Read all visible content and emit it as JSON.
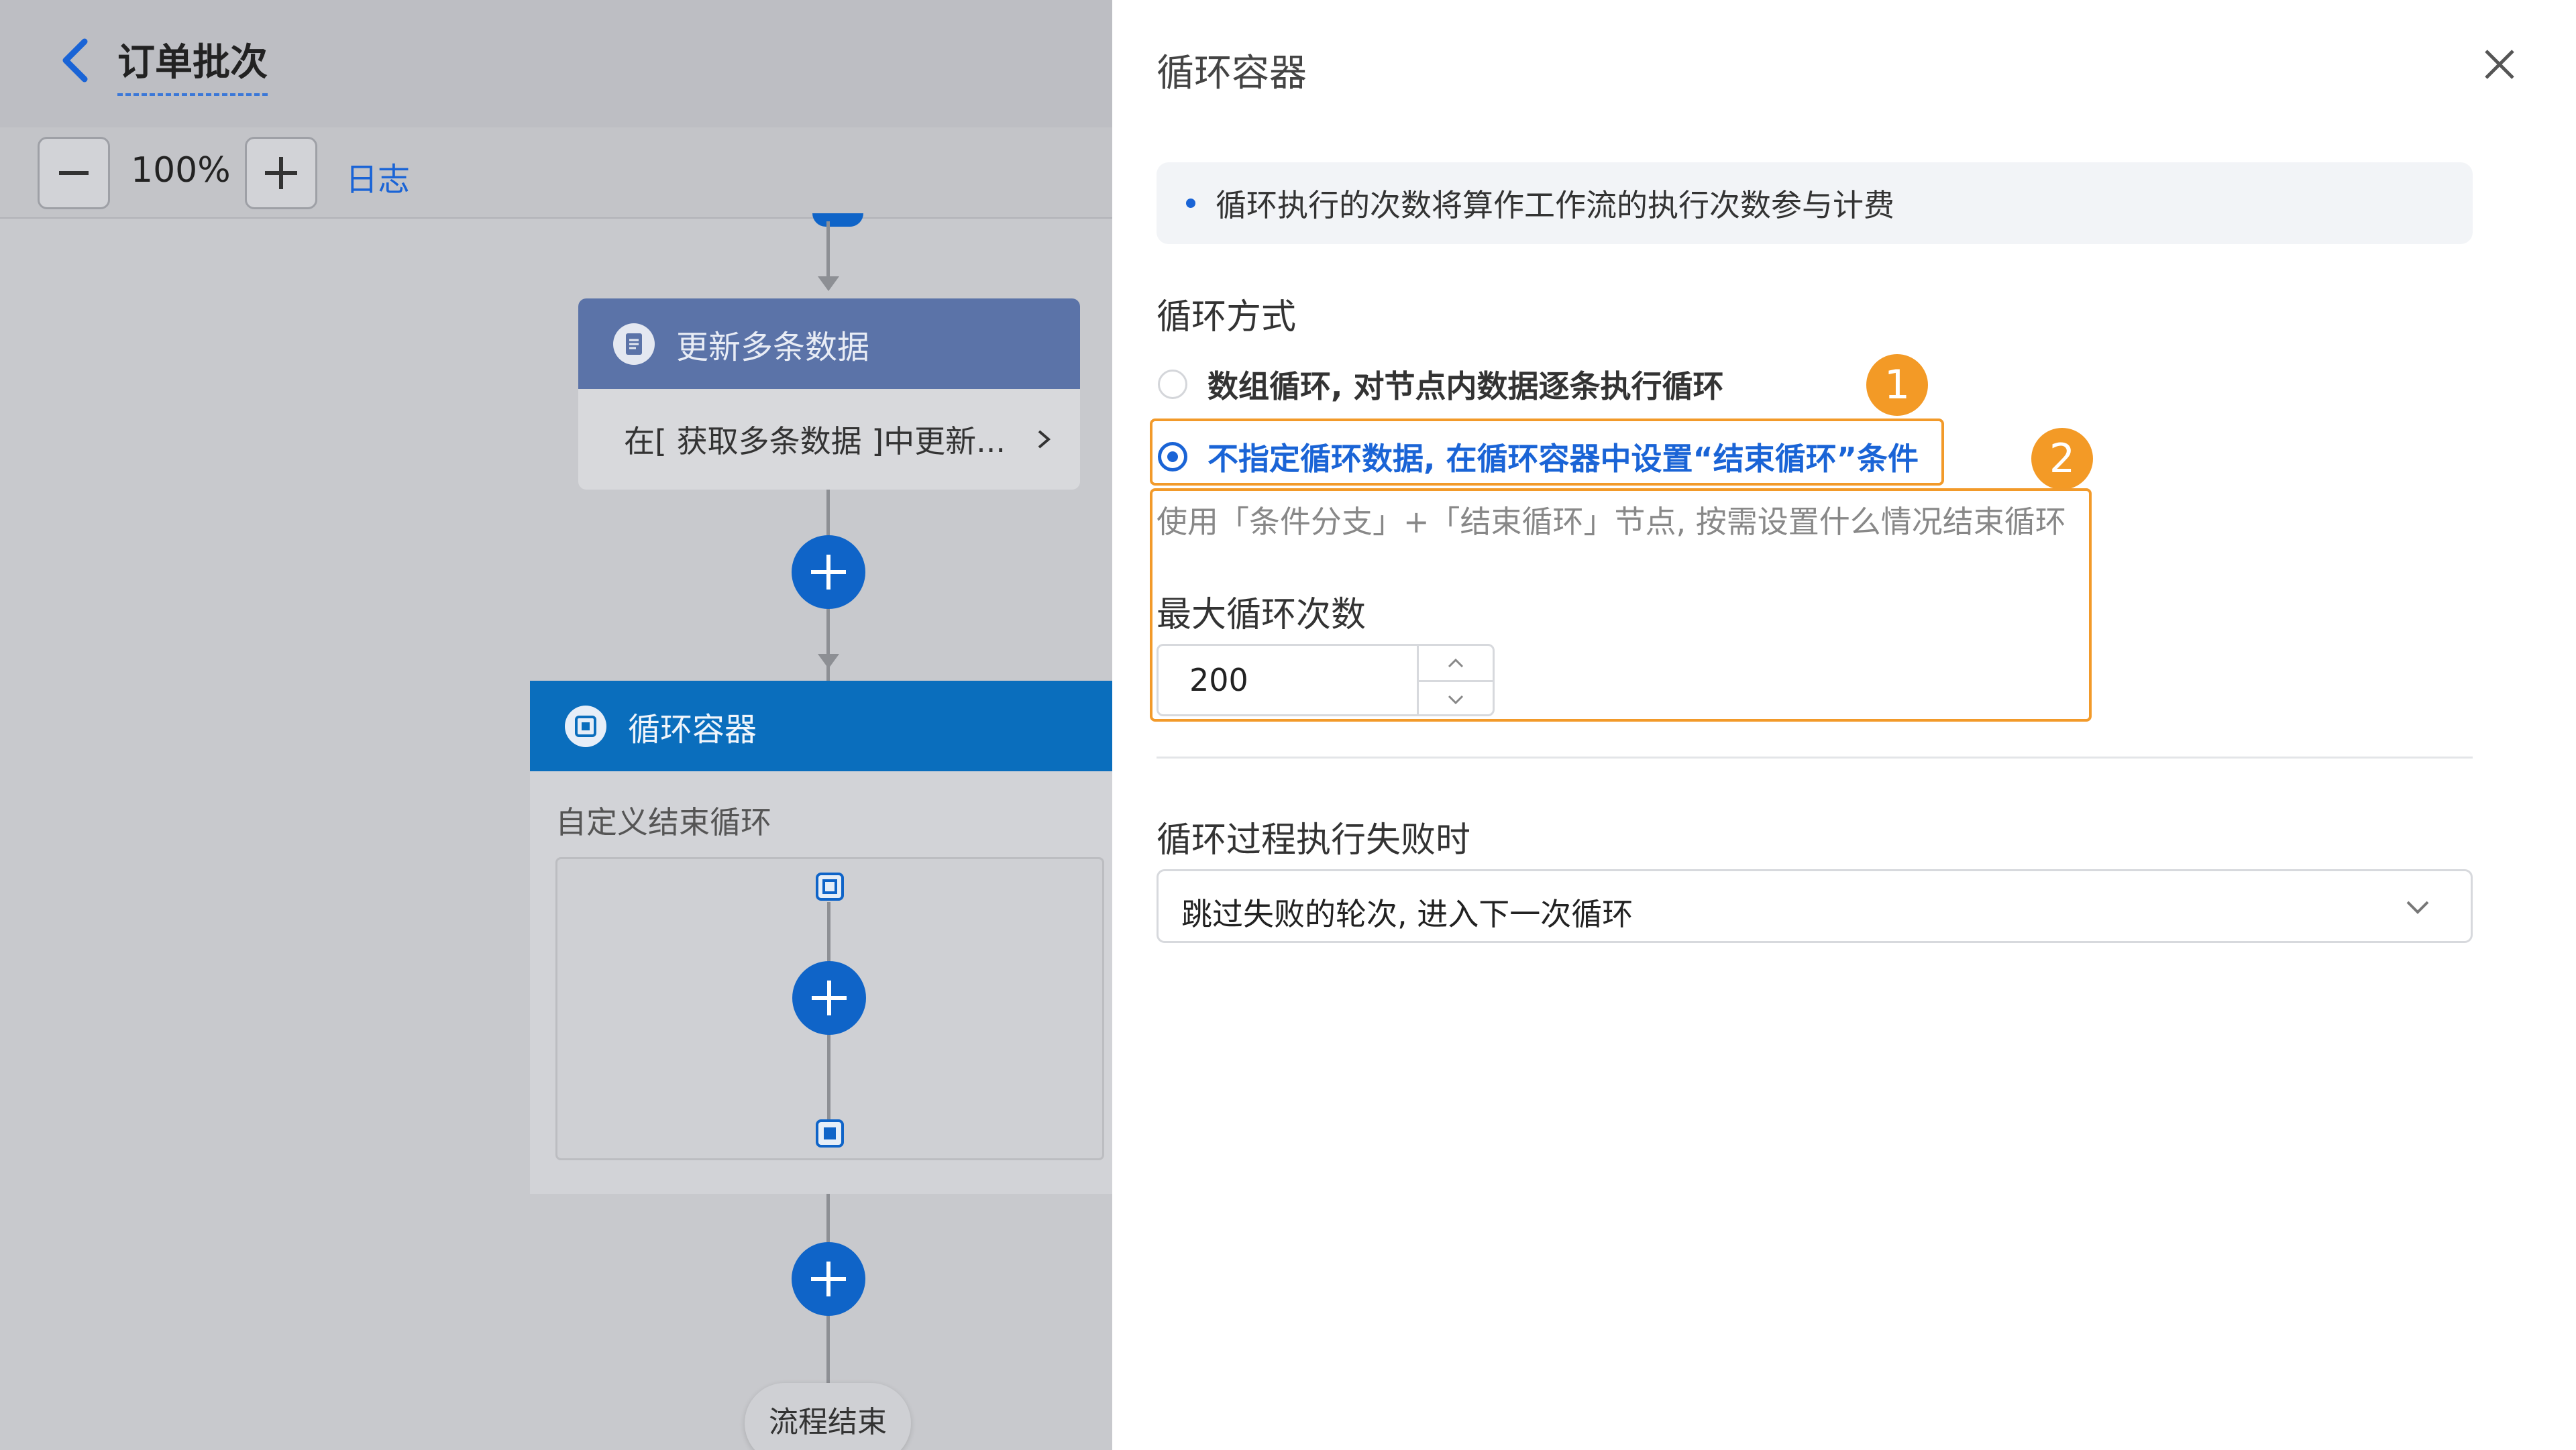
{
  "header": {
    "title": "订单批次"
  },
  "toolbar": {
    "zoom": "100%",
    "log_link": "日志"
  },
  "flow": {
    "update_node": {
      "title": "更新多条数据",
      "summary": "在[ 获取多条数据 ]中更新..."
    },
    "loop_node": {
      "title": "循环容器",
      "subtitle": "自定义结束循环"
    },
    "end_node": "流程结束"
  },
  "panel": {
    "title": "循环容器",
    "notice": "循环执行的次数将算作工作流的执行次数参与计费",
    "mode_label": "循环方式",
    "mode_options": [
      {
        "label": "数组循环, 对节点内数据逐条执行循环",
        "selected": false
      },
      {
        "label": "不指定循环数据, 在循环容器中设置“结束循环”条件",
        "selected": true
      }
    ],
    "mode_hint": "使用「条件分支」+「结束循环」节点, 按需设置什么情况结束循环",
    "max_label": "最大循环次数",
    "max_value": "200",
    "fail_label": "循环过程执行失败时",
    "fail_value": "跳过失败的轮次, 进入下一次循环"
  },
  "annotations": {
    "badge_1": "1",
    "badge_2": "2"
  },
  "colors": {
    "accent": "#1a64d6",
    "highlight": "#f29a2a",
    "loop_node_header": "#0a6ebd",
    "update_node_header": "#5b73a8"
  },
  "icons": [
    "back-arrow-icon",
    "minus-icon",
    "plus-icon",
    "document-icon",
    "loop-icon",
    "close-icon",
    "chevron-right-icon",
    "chevron-down-icon",
    "chevron-up-icon"
  ]
}
